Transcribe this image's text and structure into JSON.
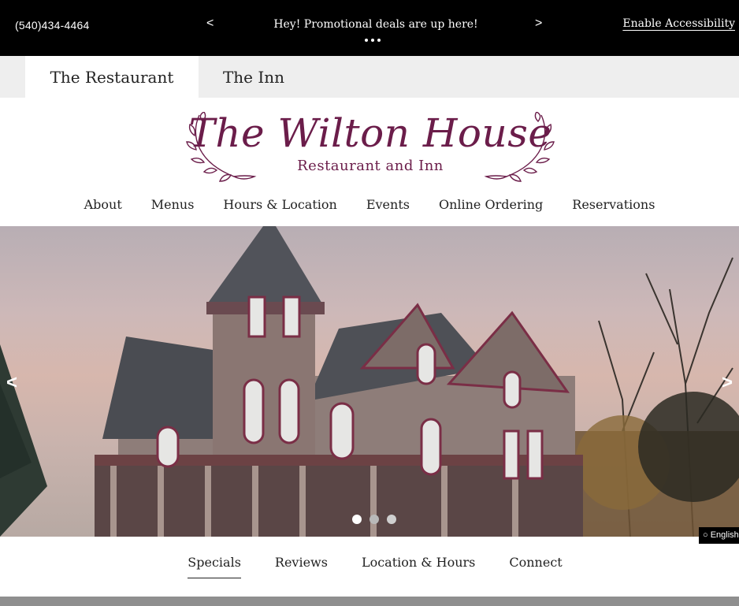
{
  "topbar": {
    "phone": "(540)434-4464",
    "prev": "<",
    "next": ">",
    "promo_text": "Hey! Promotional deals are up here!",
    "accessibility": "Enable Accessibility"
  },
  "site_tabs": [
    {
      "label": "The Restaurant",
      "active": true
    },
    {
      "label": "The Inn",
      "active": false
    }
  ],
  "logo": {
    "title": "The Wilton House",
    "subtitle": "Restaurant and Inn",
    "color": "#6b1d4a"
  },
  "main_nav": [
    "About",
    "Menus",
    "Hours & Location",
    "Events",
    "Online Ordering",
    "Reservations"
  ],
  "hero": {
    "prev": "<",
    "next": ">",
    "slide_count": 3,
    "active_slide": 1
  },
  "language": "English",
  "section_tabs": [
    {
      "label": "Specials",
      "active": true
    },
    {
      "label": "Reviews",
      "active": false
    },
    {
      "label": "Location & Hours",
      "active": false
    },
    {
      "label": "Connect",
      "active": false
    }
  ]
}
